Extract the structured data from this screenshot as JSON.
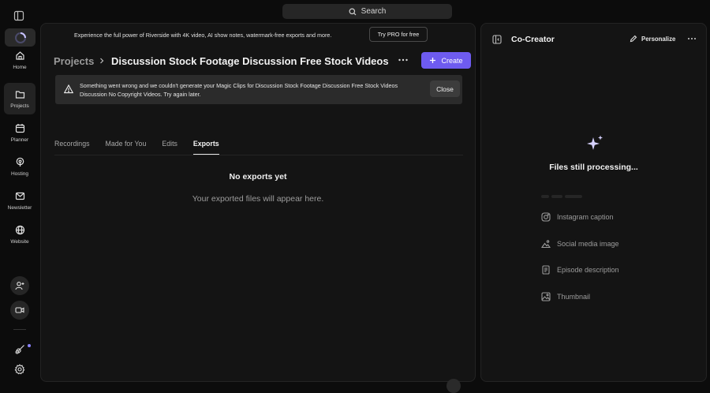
{
  "search": {
    "label": "Search"
  },
  "sidebar": {
    "items": [
      {
        "label": "Home",
        "icon": "home-icon"
      },
      {
        "label": "Projects",
        "icon": "folder-icon"
      },
      {
        "label": "Planner",
        "icon": "calendar-icon"
      },
      {
        "label": "Hosting",
        "icon": "podcast-icon"
      },
      {
        "label": "Newsletter",
        "icon": "mail-icon"
      },
      {
        "label": "Website",
        "icon": "globe-icon"
      }
    ]
  },
  "promo": {
    "text": "Experience the full power of Riverside with 4K video, AI show notes, watermark-free exports and more.",
    "cta": "Try PRO for free"
  },
  "header": {
    "breadcrumb_root": "Projects",
    "title": "Discussion Stock Footage Discussion Free Stock Videos Discussion No Copyright Videos",
    "create_label": "Create"
  },
  "alert": {
    "message": "Something went wrong and we couldn't generate your Magic Clips for Discussion Stock Footage Discussion Free Stock Videos Discussion No Copyright Videos. Try again later.",
    "close_label": "Close"
  },
  "tabs": [
    {
      "label": "Recordings",
      "active": false
    },
    {
      "label": "Made for You",
      "active": false
    },
    {
      "label": "Edits",
      "active": false
    },
    {
      "label": "Exports",
      "active": true
    }
  ],
  "empty_state": {
    "title": "No exports yet",
    "subtitle": "Your exported files will appear here."
  },
  "cocreator": {
    "title": "Co-Creator",
    "personalize_label": "Personalize",
    "status": "Files still processing...",
    "outputs": [
      {
        "label": "Instagram caption",
        "icon": "instagram-icon"
      },
      {
        "label": "Social media image",
        "icon": "image-icon"
      },
      {
        "label": "Episode description",
        "icon": "document-icon"
      },
      {
        "label": "Thumbnail",
        "icon": "thumbnail-icon"
      }
    ]
  },
  "colors": {
    "accent": "#6e5bf0",
    "background": "#0c0c0c",
    "panel": "#141414"
  }
}
